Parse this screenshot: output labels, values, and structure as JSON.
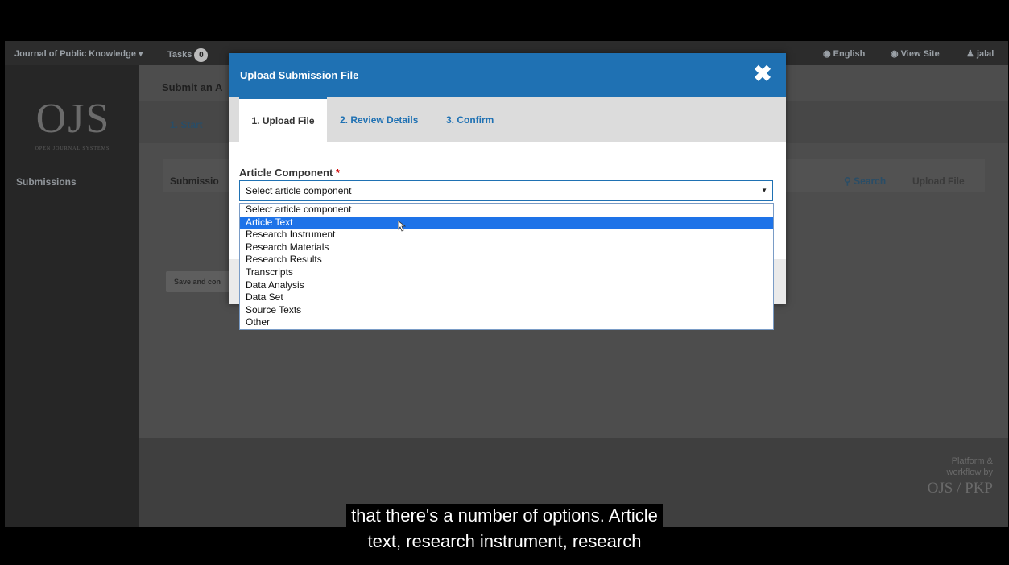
{
  "topbar": {
    "journal": "Journal of Public Knowledge",
    "tasks_label": "Tasks",
    "tasks_count": "0",
    "language": "English",
    "view_site": "View Site",
    "user": "jalal"
  },
  "sidebar": {
    "logo": "OJS",
    "logo_sub": "OPEN JOURNAL SYSTEMS",
    "link": "Submissions"
  },
  "main": {
    "title": "Submit an A",
    "tab_start": "1. Start",
    "panel_label": "Submissio",
    "search": "Search",
    "upload_file": "Upload File",
    "save_button": "Save and con"
  },
  "footer": {
    "line1": "Platform &",
    "line2": "workflow by",
    "logo": "OJS / PKP"
  },
  "modal": {
    "title": "Upload Submission File",
    "tabs": [
      "1. Upload File",
      "2. Review Details",
      "3. Confirm"
    ],
    "field_label": "Article Component",
    "required_mark": "*",
    "select_value": "Select article component",
    "options": [
      "Select article component",
      "Article Text",
      "Research Instrument",
      "Research Materials",
      "Research Results",
      "Transcripts",
      "Data Analysis",
      "Data Set",
      "Source Texts",
      "Other"
    ],
    "highlighted_option": "Article Text"
  },
  "caption": {
    "line1": "that there's a number of options. Article",
    "line2": "text, research instrument, research"
  },
  "colors": {
    "accent": "#1f71b3",
    "highlight": "#1e73e8",
    "required": "#d00000"
  }
}
